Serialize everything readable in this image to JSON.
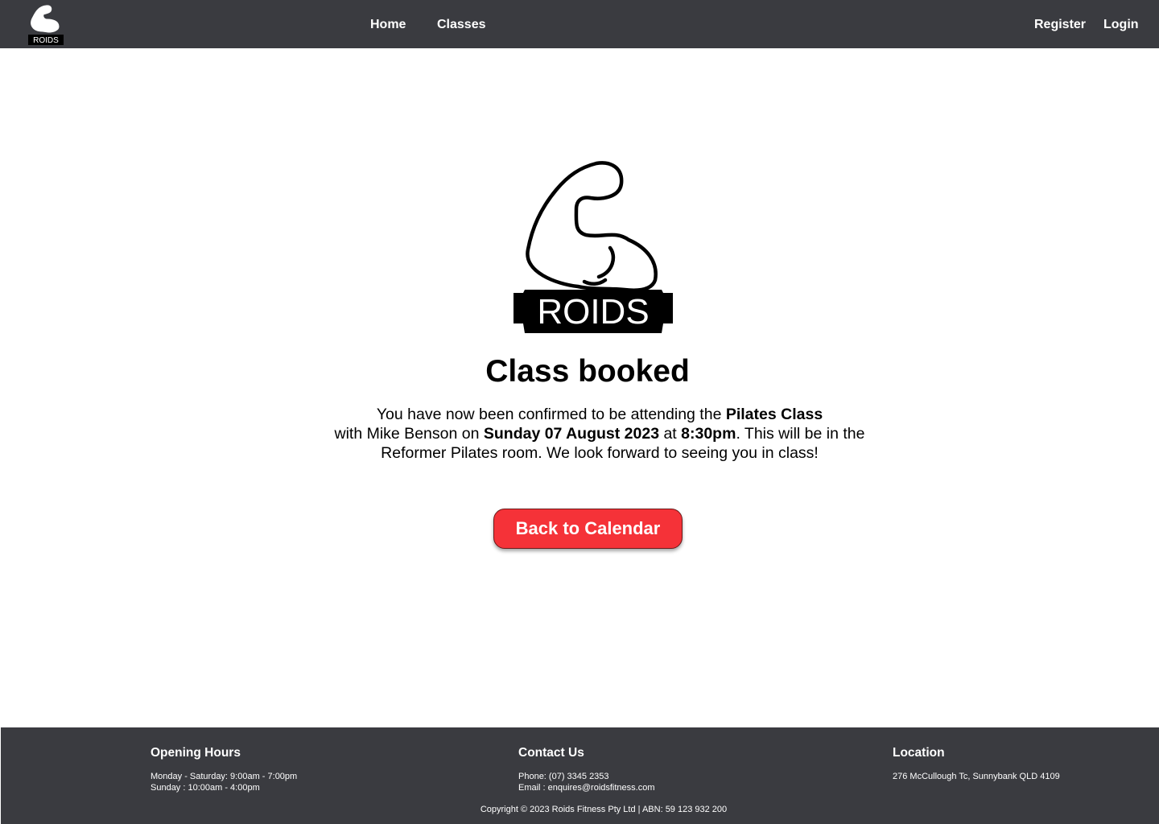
{
  "nav": {
    "logo_text": "ROIDS",
    "home_label": "Home",
    "classes_label": "Classes",
    "register_label": "Register",
    "login_label": "Login"
  },
  "hero": {
    "logo_text": "ROIDS"
  },
  "confirmation": {
    "title": "Class booked",
    "line1_prefix": "You have now been confirmed to be attending the ",
    "class_name": "Pilates Class",
    "line2_prefix": "with Mike Benson on ",
    "date": "Sunday 07 August 2023",
    "at_text": " at ",
    "time": "8:30pm",
    "line2_suffix": ". This will be in the",
    "line3": "Reformer Pilates room. We look forward to seeing you in class!",
    "back_button_label": "Back to Calendar"
  },
  "footer": {
    "hours_heading": "Opening Hours",
    "hours_weekday": "Monday - Saturday: 9:00am - 7:00pm",
    "hours_sunday": "Sunday : 10:00am - 4:00pm",
    "contact_heading": "Contact Us",
    "phone": "Phone: (07) 3345 2353",
    "email": "Email : enquires@roidsfitness.com",
    "location_heading": "Location",
    "address": "276 McCullough Tc, Sunnybank QLD 4109",
    "copyright": "Copyright © 2023 Roids Fitness Pty Ltd | ABN: 59 123 932 200"
  },
  "colors": {
    "nav_bg": "#3a3b40",
    "accent_button": "#f53238",
    "footer_bg": "#3a3b40"
  }
}
